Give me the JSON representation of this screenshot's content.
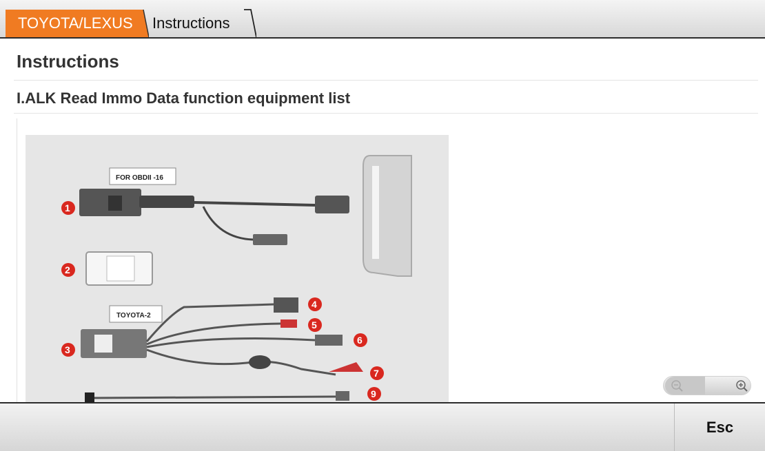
{
  "tabs": {
    "brand": "TOYOTA/LEXUS",
    "current": "Instructions"
  },
  "main": {
    "title": "Instructions",
    "section_title": "I.ALK Read Immo Data function equipment list"
  },
  "figure": {
    "callout_obd": "FOR OBDII -16",
    "callout_toyota": "TOYOTA-2",
    "numbers": [
      "1",
      "2",
      "3",
      "4",
      "5",
      "6",
      "7",
      "9"
    ]
  },
  "zoom": {
    "out_icon": "zoom-out-icon",
    "in_icon": "zoom-in-icon"
  },
  "footer": {
    "esc_label": "Esc"
  },
  "colors": {
    "accent": "#f07b22",
    "marker": "#d9281f"
  }
}
